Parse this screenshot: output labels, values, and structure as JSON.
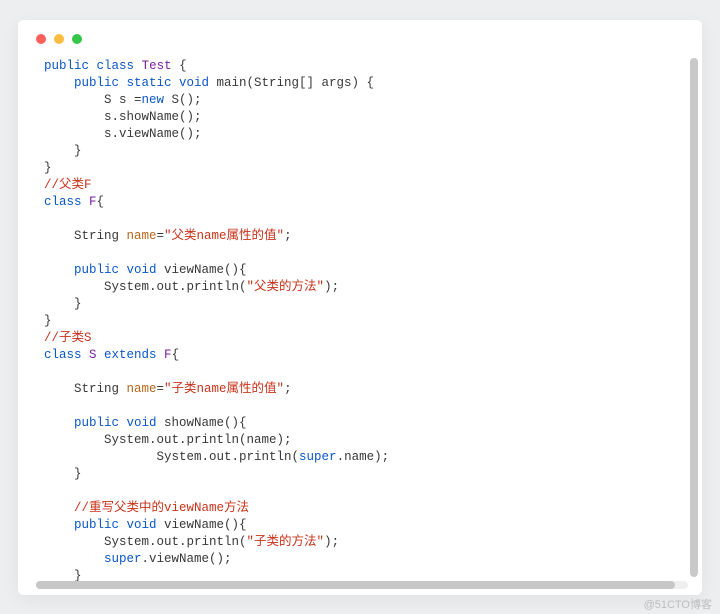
{
  "window": {
    "dot_red": "#fc605c",
    "dot_yellow": "#fdbc40",
    "dot_green": "#34c749"
  },
  "code": {
    "l01_a": "public",
    "l01_b": "class",
    "l01_c": "Test",
    "l01_d": " {",
    "l02_a": "    public static void",
    "l02_b": " main(String[] args) {",
    "l03_a": "        S s =",
    "l03_b": "new",
    "l03_c": " S();",
    "l04": "        s.showName();",
    "l05": "        s.viewName();",
    "l06": "    }",
    "l07": "}",
    "l08": "//父类F",
    "l09_a": "class",
    "l09_b": " F",
    "l09_c": "{",
    "l10": "",
    "l11_a": "    String ",
    "l11_b": "name",
    "l11_c": "=",
    "l11_d": "\"父类name属性的值\"",
    "l11_e": ";",
    "l12": "",
    "l13_a": "    public void",
    "l13_b": " viewName(){",
    "l14_a": "        System.out.println(",
    "l14_b": "\"父类的方法\"",
    "l14_c": ");",
    "l15": "    }",
    "l16": "}",
    "l17": "//子类S",
    "l18_a": "class",
    "l18_b": " S ",
    "l18_c": "extends",
    "l18_d": " F",
    "l18_e": "{",
    "l19": "",
    "l20_a": "    String ",
    "l20_b": "name",
    "l20_c": "=",
    "l20_d": "\"子类name属性的值\"",
    "l20_e": ";",
    "l21": "",
    "l22_a": "    public void",
    "l22_b": " showName(){",
    "l23": "        System.out.println(name);",
    "l24_a": "               System.out.println(",
    "l24_b": "super",
    "l24_c": ".name);",
    "l25": "    }",
    "l26": "",
    "l27": "    //重写父类中的viewName方法",
    "l28_a": "    public void",
    "l28_b": " viewName(){",
    "l29_a": "        System.out.println(",
    "l29_b": "\"子类的方法\"",
    "l29_c": ");",
    "l30_a": "        ",
    "l30_b": "super",
    "l30_c": ".viewName();",
    "l31": "    }",
    "l32": "}"
  },
  "watermark": "@51CTO博客"
}
